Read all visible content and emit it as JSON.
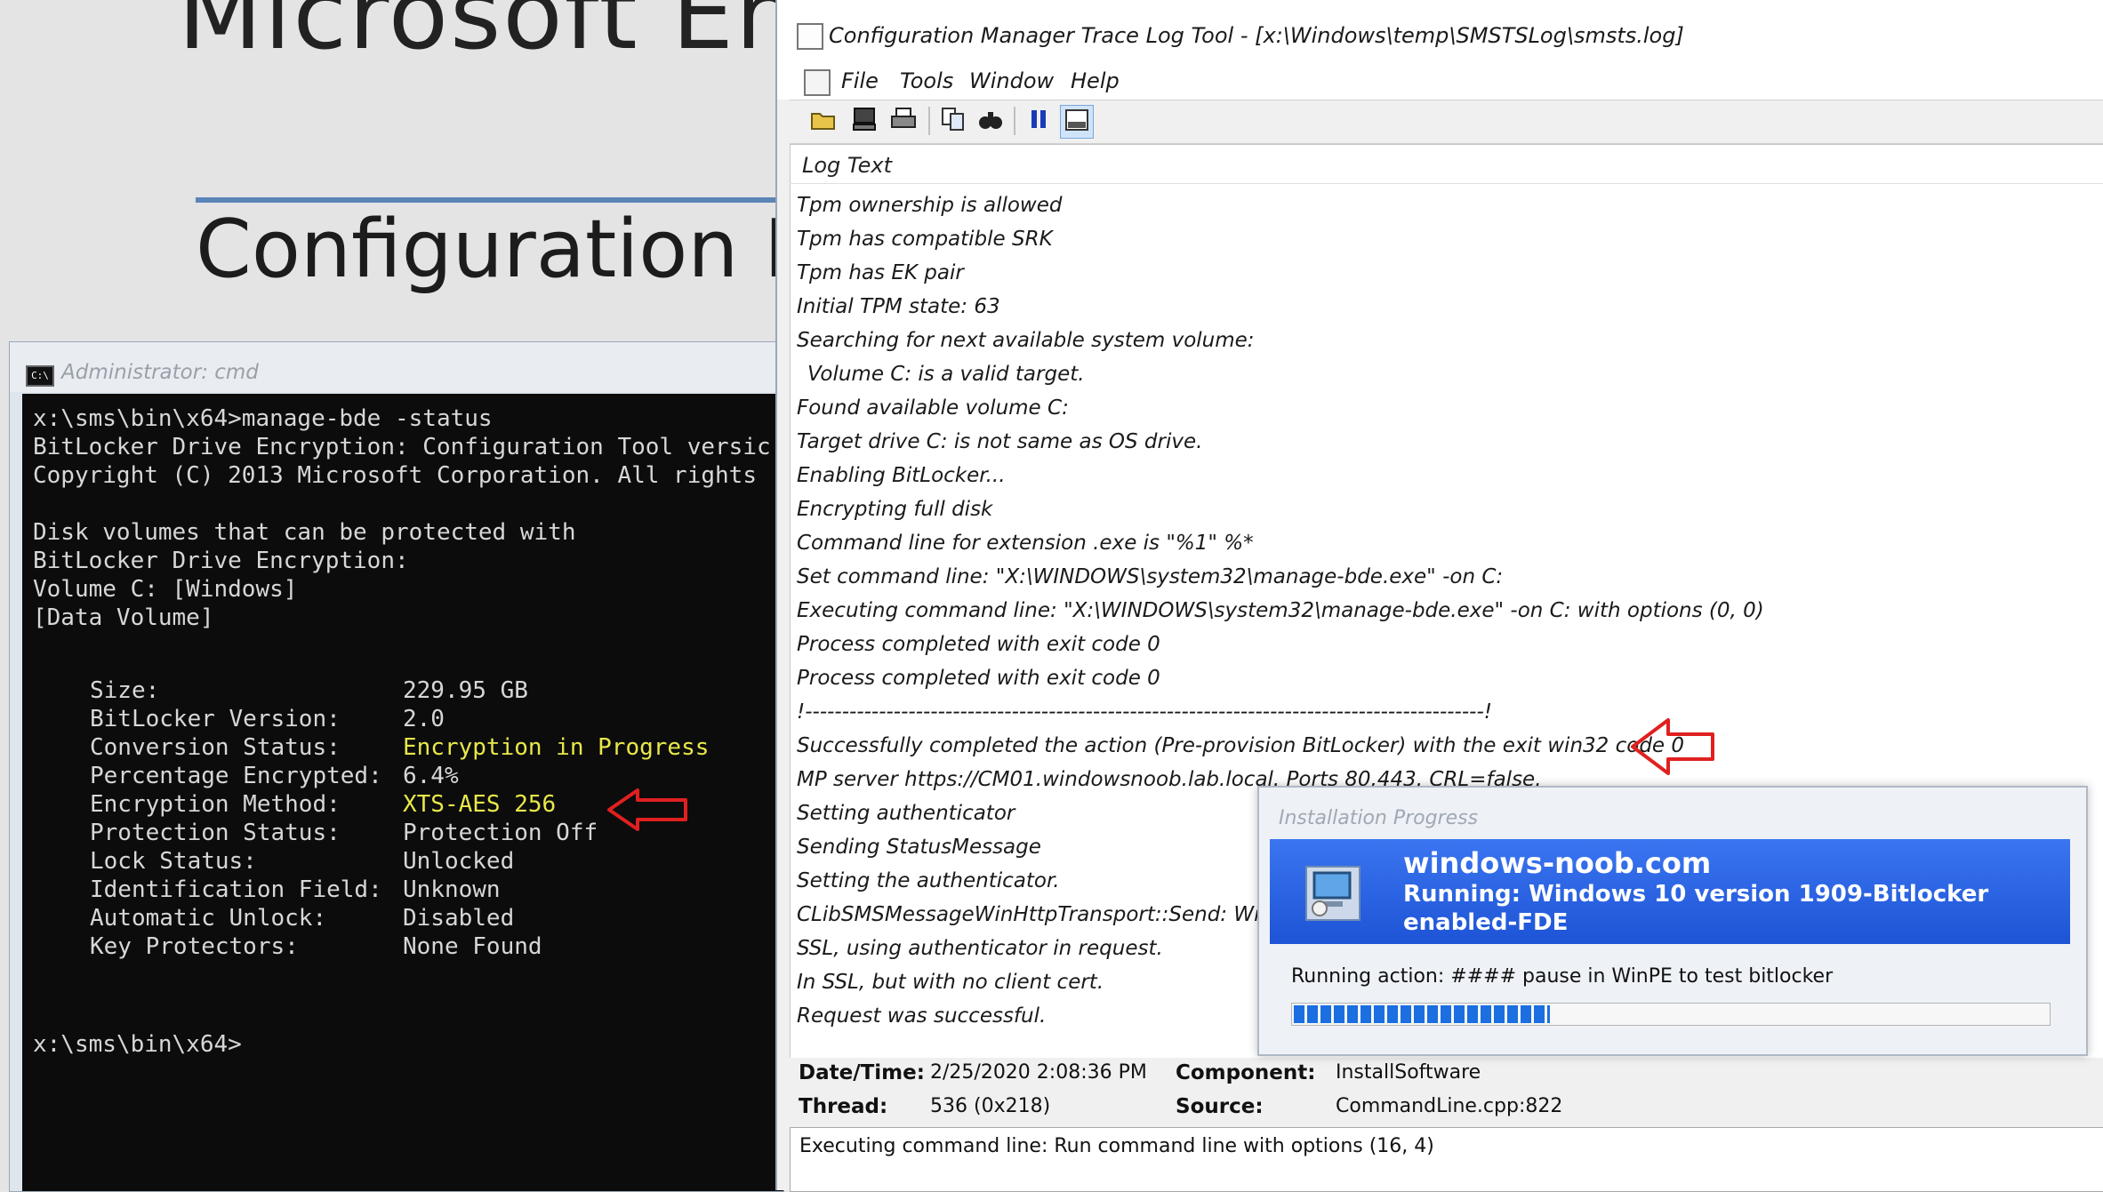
{
  "background": {
    "top_text": "Microsoft Endpo",
    "title": "Configuration M"
  },
  "cmd": {
    "title": "Administrator: cmd",
    "icon": "console-icon",
    "lines": [
      "x:\\sms\\bin\\x64>manage-bde -status",
      "BitLocker Drive Encryption: Configuration Tool versic",
      "Copyright (C) 2013 Microsoft Corporation. All rights",
      "",
      "Disk volumes that can be protected with",
      "BitLocker Drive Encryption:",
      "Volume C: [Windows]",
      "[Data Volume]"
    ],
    "fields": [
      {
        "label": "Size:",
        "value": "229.95 GB",
        "highlight": false
      },
      {
        "label": "BitLocker Version:",
        "value": "2.0",
        "highlight": false
      },
      {
        "label": "Conversion Status:",
        "value": "Encryption in Progress",
        "highlight": true
      },
      {
        "label": "Percentage Encrypted:",
        "value": "6.4%",
        "highlight": false
      },
      {
        "label": "Encryption Method:",
        "value": "XTS-AES 256",
        "highlight": true
      },
      {
        "label": "Protection Status:",
        "value": "Protection Off",
        "highlight": false
      },
      {
        "label": "Lock Status:",
        "value": "Unlocked",
        "highlight": false
      },
      {
        "label": "Identification Field:",
        "value": "Unknown",
        "highlight": false
      },
      {
        "label": "Automatic Unlock:",
        "value": "Disabled",
        "highlight": false
      },
      {
        "label": "Key Protectors:",
        "value": "None Found",
        "highlight": false
      }
    ],
    "prompt": "x:\\sms\\bin\\x64>"
  },
  "trace": {
    "title": "Configuration Manager Trace Log Tool - [x:\\Windows\\temp\\SMSTSLog\\smsts.log]",
    "menu": [
      "File",
      "Tools",
      "Window",
      "Help"
    ],
    "toolbar_icons": [
      "open-folder-icon",
      "computer-icon",
      "print-icon",
      "copy-icon",
      "find-icon",
      "pause-icon",
      "panel-icon"
    ],
    "column_header": "Log Text",
    "log_lines": [
      "Tpm ownership is allowed",
      "Tpm has compatible SRK",
      "Tpm has EK pair",
      "Initial TPM state: 63",
      "Searching for next available system volume:",
      "  Volume C: is a valid target.",
      "Found available volume C:",
      "Target drive C: is not same as OS drive.",
      "Enabling BitLocker...",
      "Encrypting full disk",
      "Command line for extension .exe is \"%1\" %*",
      "Set command line: \"X:\\WINDOWS\\system32\\manage-bde.exe\" -on C:",
      "Executing command line: \"X:\\WINDOWS\\system32\\manage-bde.exe\" -on C: with options (0, 0)",
      "Process completed with exit code 0",
      "Process completed with exit code 0",
      "!--------------------------------------------------------------------------------------------!",
      "Successfully completed the action (Pre-provision BitLocker) with the exit win32 code 0",
      "MP server https://CM01.windowsnoob.lab.local. Ports 80,443. CRL=false.",
      "Setting authenticator",
      "Sending StatusMessage",
      "Setting the authenticator.",
      "CLibSMSMessageWinHttpTransport::Send: WinHt",
      "SSL, using authenticator in request.",
      "In SSL, but with no client cert.",
      "Request was successful."
    ],
    "details": {
      "datetime_label": "Date/Time:",
      "datetime_value": "2/25/2020 2:08:36 PM",
      "component_label": "Component:",
      "component_value": "InstallSoftware",
      "thread_label": "Thread:",
      "thread_value": "536 (0x218)",
      "source_label": "Source:",
      "source_value": "CommandLine.cpp:822"
    },
    "detail_text": "Executing command line: Run command line with options (16, 4)"
  },
  "install": {
    "title": "Installation Progress",
    "org": "windows-noob.com",
    "running": "Running: Windows 10 version 1909-Bitlocker enabled-FDE",
    "action": "Running action: #### pause in WinPE to test bitlocker",
    "progress": 0.34
  },
  "colors": {
    "arrow": "#e02020",
    "cmd_highlight": "#e8e84a",
    "banner": "#2a63e4"
  }
}
